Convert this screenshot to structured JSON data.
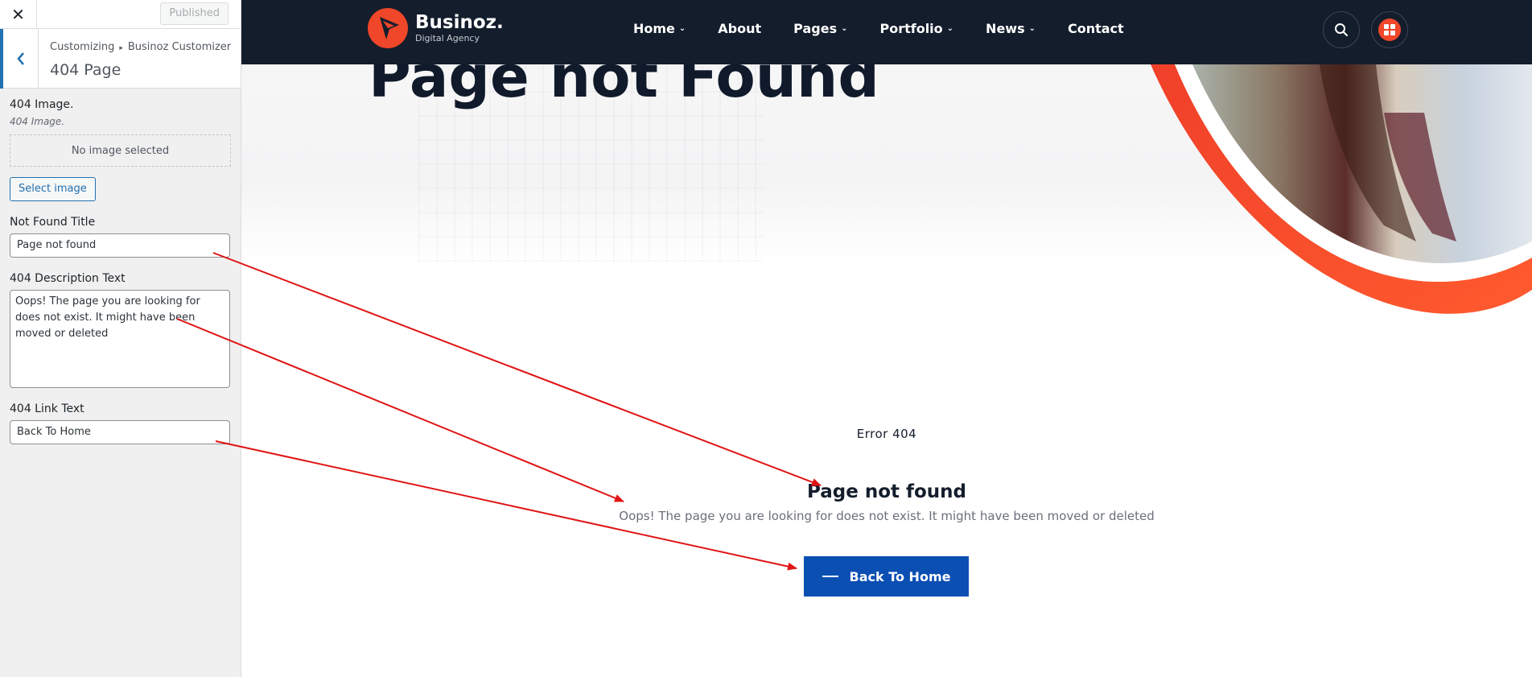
{
  "sidebar": {
    "close_glyph": "✕",
    "published_label": "Published",
    "breadcrumb_root": "Customizing",
    "breadcrumb_sep": "▸",
    "breadcrumb_section": "Businoz Customizer",
    "section_title": "404 Page",
    "fields": {
      "image_label": "404 Image.",
      "image_desc": "404 Image.",
      "no_image_text": "No image selected",
      "select_image_label": "Select image",
      "title_label": "Not Found Title",
      "title_value": "Page not found",
      "description_label": "404 Description Text",
      "description_value": "Oops! The page you are looking for does not exist. It might have been moved or deleted",
      "link_label": "404 Link Text",
      "link_value": "Back To Home"
    }
  },
  "navbar": {
    "brand_name": "Businoz.",
    "brand_tagline": "Digital Agency",
    "menu": [
      {
        "label": "Home",
        "has_dropdown": true
      },
      {
        "label": "About",
        "has_dropdown": false
      },
      {
        "label": "Pages",
        "has_dropdown": true
      },
      {
        "label": "Portfolio",
        "has_dropdown": true
      },
      {
        "label": "News",
        "has_dropdown": true
      },
      {
        "label": "Contact",
        "has_dropdown": false
      }
    ],
    "chevron_glyph": "⌄",
    "icons": {
      "search": "search-icon",
      "menu": "grid-icon"
    }
  },
  "hero": {
    "title": "Page not Found"
  },
  "content": {
    "error_code": "Error 404",
    "title": "Page not found",
    "description": "Oops! The page you are looking for does not exist. It might have been moved or deleted",
    "button_label": "Back To Home"
  },
  "colors": {
    "brand_accent": "#f0462a",
    "navbar_bg": "#141d2c",
    "button_bg": "#0b4fb3",
    "annotation_arrow": "#e01414"
  }
}
